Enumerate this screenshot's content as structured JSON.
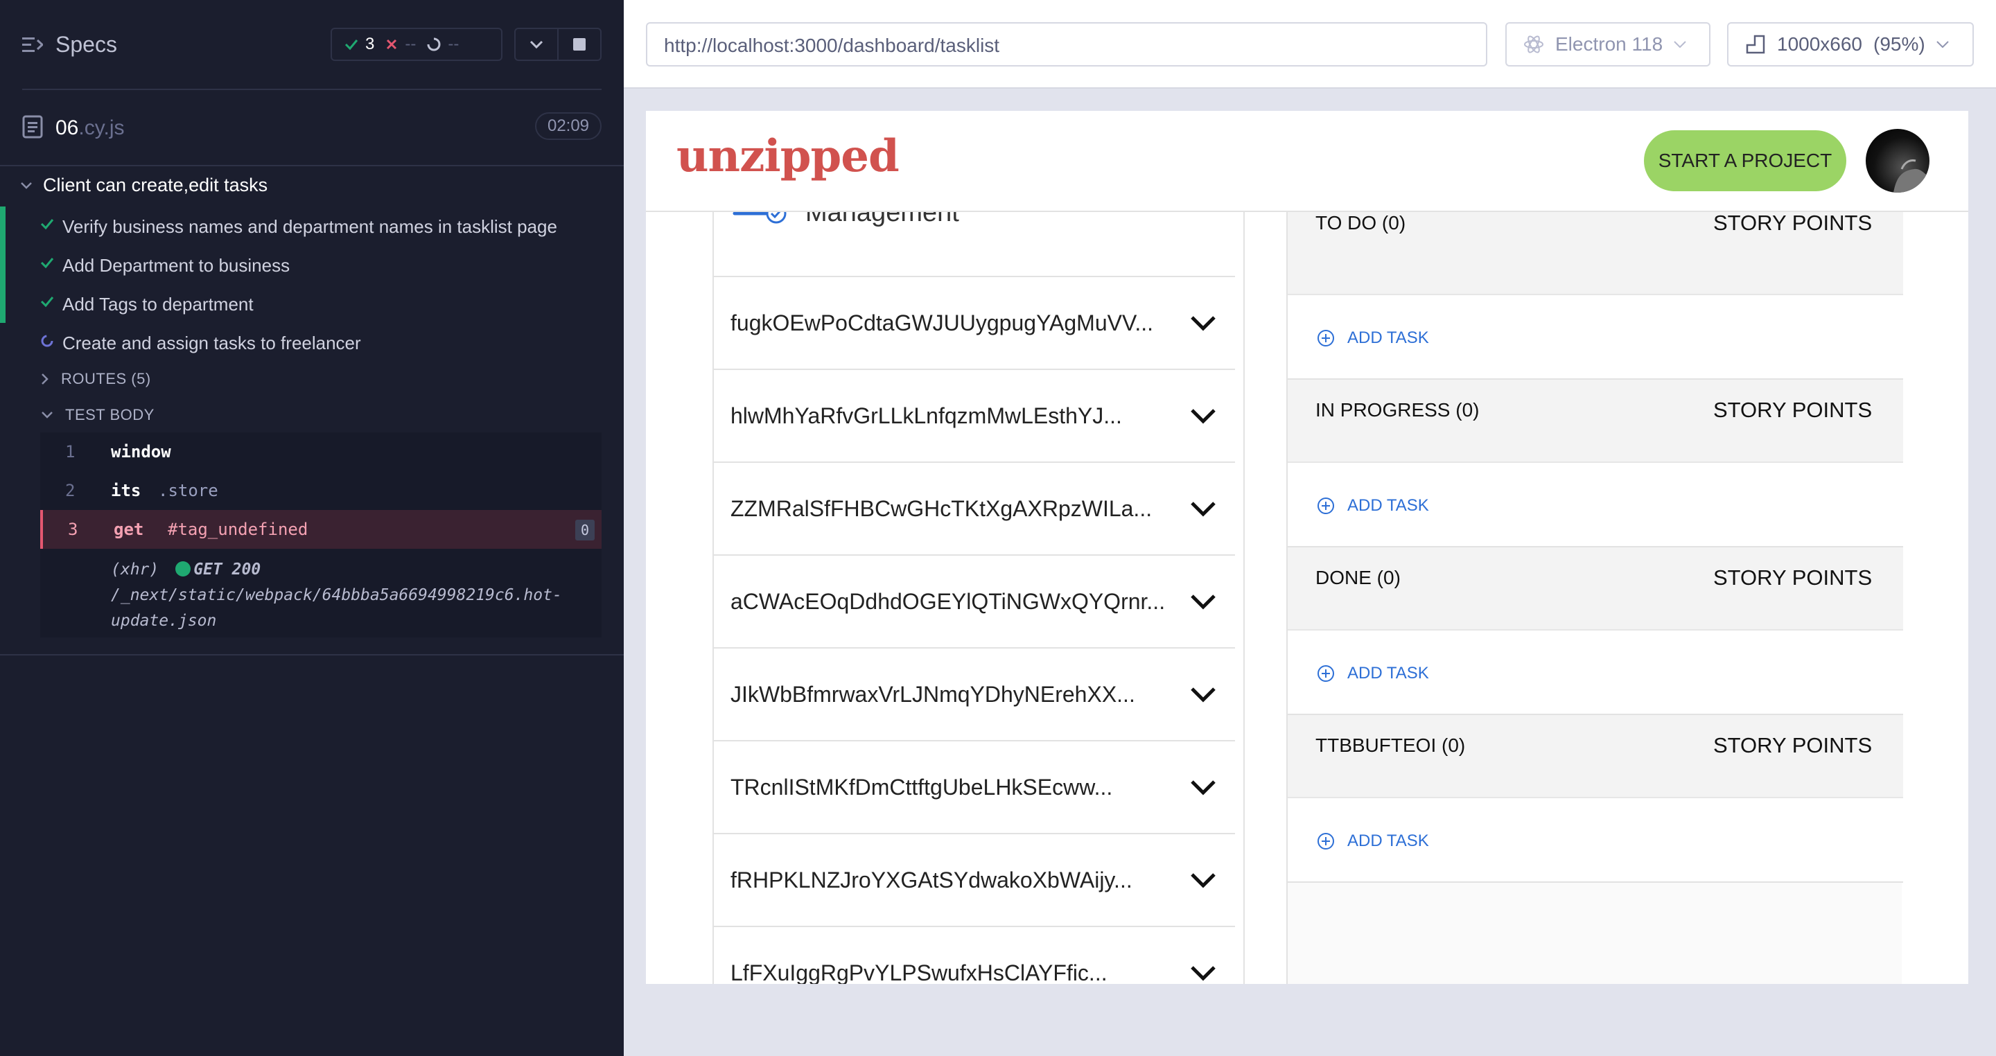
{
  "runner": {
    "title": "Specs",
    "stats": {
      "passed": "3",
      "failed": "--",
      "pending": "--"
    },
    "spec_file": {
      "name": "06",
      "ext": ".cy.js",
      "duration": "02:09"
    },
    "suite_title": "Client can create,edit tasks",
    "tests": [
      {
        "label": "Verify business names and department names in tasklist page",
        "state": "passed"
      },
      {
        "label": "Add Department to business",
        "state": "passed"
      },
      {
        "label": "Add Tags to department",
        "state": "passed"
      },
      {
        "label": "Create and assign tasks to freelancer",
        "state": "running"
      }
    ],
    "routes_label": "ROUTES (5)",
    "test_body_label": "TEST BODY",
    "commands": [
      {
        "line": "1",
        "name": "window",
        "arg": ""
      },
      {
        "line": "2",
        "name": "its",
        "arg": ".store"
      },
      {
        "line": "3",
        "name": "get",
        "arg": "#tag_undefined",
        "count": "0"
      }
    ],
    "xhr": {
      "type": "(xhr)",
      "method": "GET 200",
      "url": "/_next/static/webpack/64bbba5a6694998219c6.hot-update.json"
    }
  },
  "browser_bar": {
    "url": "http://localhost:3000/dashboard/tasklist",
    "browser": "Electron 118",
    "viewport": "1000x660",
    "zoom": "(95%)"
  },
  "app": {
    "logo": "unzipped",
    "start_button": "START A PROJECT",
    "section_title": "Management",
    "departments": [
      "fugkOEwPoCdtaGWJUUygpugYAgMuVV...",
      "hlwMhYaRfvGrLLkLnfqzmMwLEsthYJ...",
      "ZZMRalSfFHBCwGHcTKtXgAXRpzWILa...",
      "aCWAcEOqDdhdOGEYlQTiNGWxQYQrnr...",
      "JIkWbBfmrwaxVrLJNmqYDhyNErehXX...",
      "TRcnlIStMKfDmCttftgUbeLHkSEcww...",
      "fRHPKLNZJroYXGAtSYdwakoXbWAijy...",
      "LfFXuIggRgPvYLPSwufxHsClAYFfic..."
    ],
    "statuses": [
      {
        "label": "TO DO (0)",
        "points": "STORY POINTS",
        "add": "ADD TASK"
      },
      {
        "label": "IN PROGRESS (0)",
        "points": "STORY POINTS",
        "add": "ADD TASK"
      },
      {
        "label": "DONE (0)",
        "points": "STORY POINTS",
        "add": "ADD TASK"
      },
      {
        "label": "TTBBUFTEOI (0)",
        "points": "STORY POINTS",
        "add": "ADD TASK"
      }
    ]
  },
  "colors": {
    "pass": "#1fa971",
    "fail": "#e45770",
    "brand": "#d1524e",
    "cta": "#9bd465",
    "link": "#2d6fd6"
  }
}
